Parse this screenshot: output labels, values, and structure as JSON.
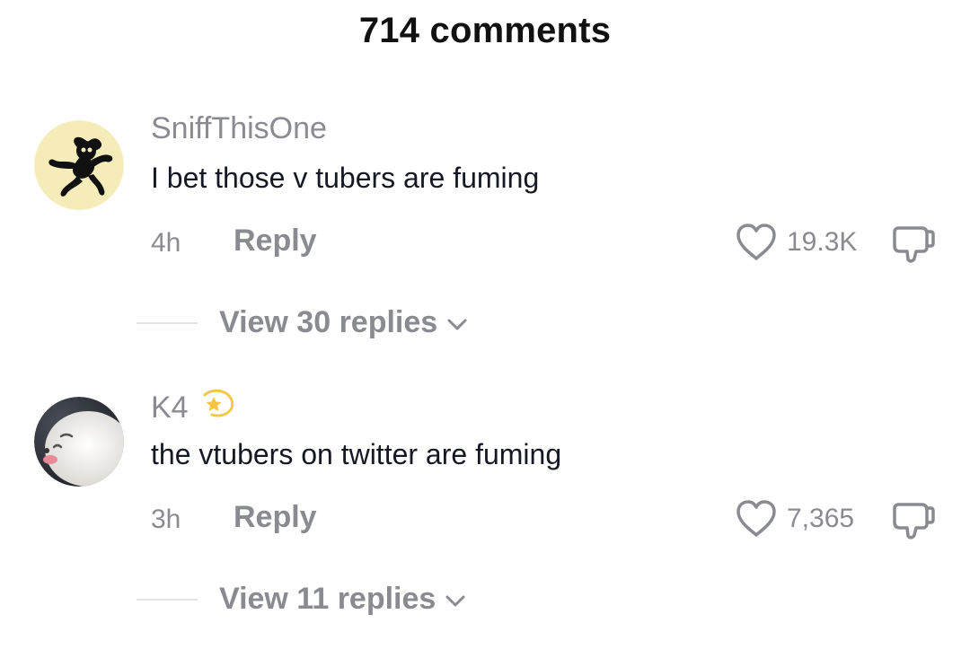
{
  "header": {
    "title": "714 comments"
  },
  "comments": [
    {
      "username": "SniffThisOne",
      "avatar_icon": "dancing-figure-avatar",
      "text": "I bet those v tubers are fuming",
      "time": "4h",
      "reply_label": "Reply",
      "likes": "19.3K",
      "view_replies_label": "View 30 replies"
    },
    {
      "username": "K4",
      "badge_icon": "dizzy-star-emoji",
      "avatar_icon": "seal-avatar",
      "text": "the vtubers on twitter are fuming",
      "time": "3h",
      "reply_label": "Reply",
      "likes": "7,365",
      "view_replies_label": "View 11 replies"
    }
  ],
  "colors": {
    "primary_text": "#161823",
    "secondary_text": "#8a8b91",
    "divider": "#e3e3e4"
  }
}
